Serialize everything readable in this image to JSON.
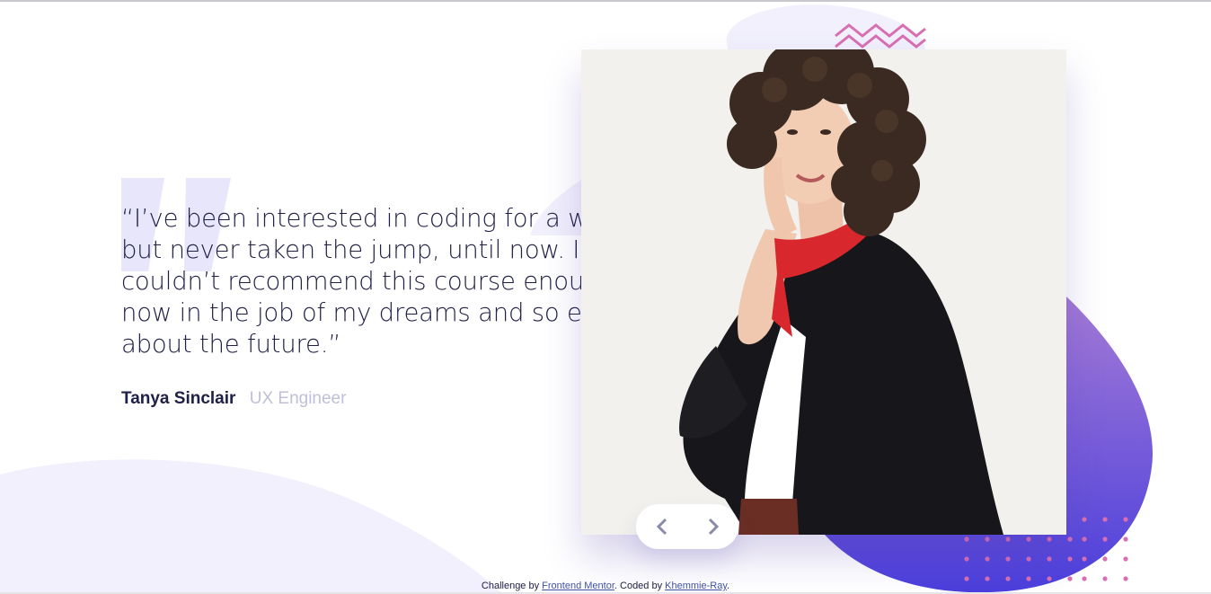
{
  "testimonial": {
    "quote": "“I’ve been interested in coding for a while but never taken the jump, until now. I couldn’t recommend this course enough. I’m now in the job of my dreams and so excited about the future.”",
    "name": "Tanya Sinclair",
    "role": "UX Engineer"
  },
  "photo": {
    "alt": "Tanya Sinclair"
  },
  "navigation": {
    "prev_icon": "chevron-left-icon",
    "next_icon": "chevron-right-icon"
  },
  "footer": {
    "prefix": "Challenge by",
    "frontend_mentor": "Frontend Mentor",
    "middle": ". Coded by",
    "coder": "Khemmie-Ray",
    "suffix": "."
  },
  "colors": {
    "text": "#202046",
    "role": "#c0bfd8",
    "accent_purple": "#6b53d6",
    "blob_light": "#f1f0fc",
    "zigzag": "#d86fb3",
    "dots": "#d86fb3",
    "link": "#3e52a3"
  }
}
